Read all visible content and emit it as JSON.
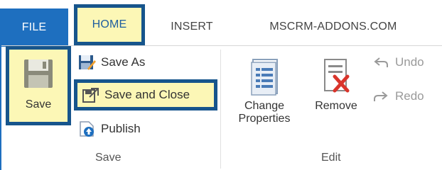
{
  "tabs": {
    "file": "FILE",
    "home": "HOME",
    "insert": "INSERT",
    "addons": "MSCRM-ADDONS.COM"
  },
  "save_group": {
    "save_label": "Save",
    "save_as_label": "Save As",
    "save_close_label": "Save and Close",
    "publish_label": "Publish",
    "group_label": "Save"
  },
  "edit_group": {
    "change_properties_line1": "Change",
    "change_properties_line2": "Properties",
    "remove_label": "Remove",
    "undo_label": "Undo",
    "redo_label": "Redo",
    "group_label": "Edit"
  },
  "colors": {
    "file_tab": "#1e6fbf",
    "highlight_fill": "#fcf7b6",
    "highlight_border": "#17558c"
  },
  "icons": [
    "floppy-disk-icon",
    "save-as-icon",
    "save-close-icon",
    "publish-icon",
    "change-properties-icon",
    "remove-icon",
    "undo-icon",
    "redo-icon"
  ]
}
